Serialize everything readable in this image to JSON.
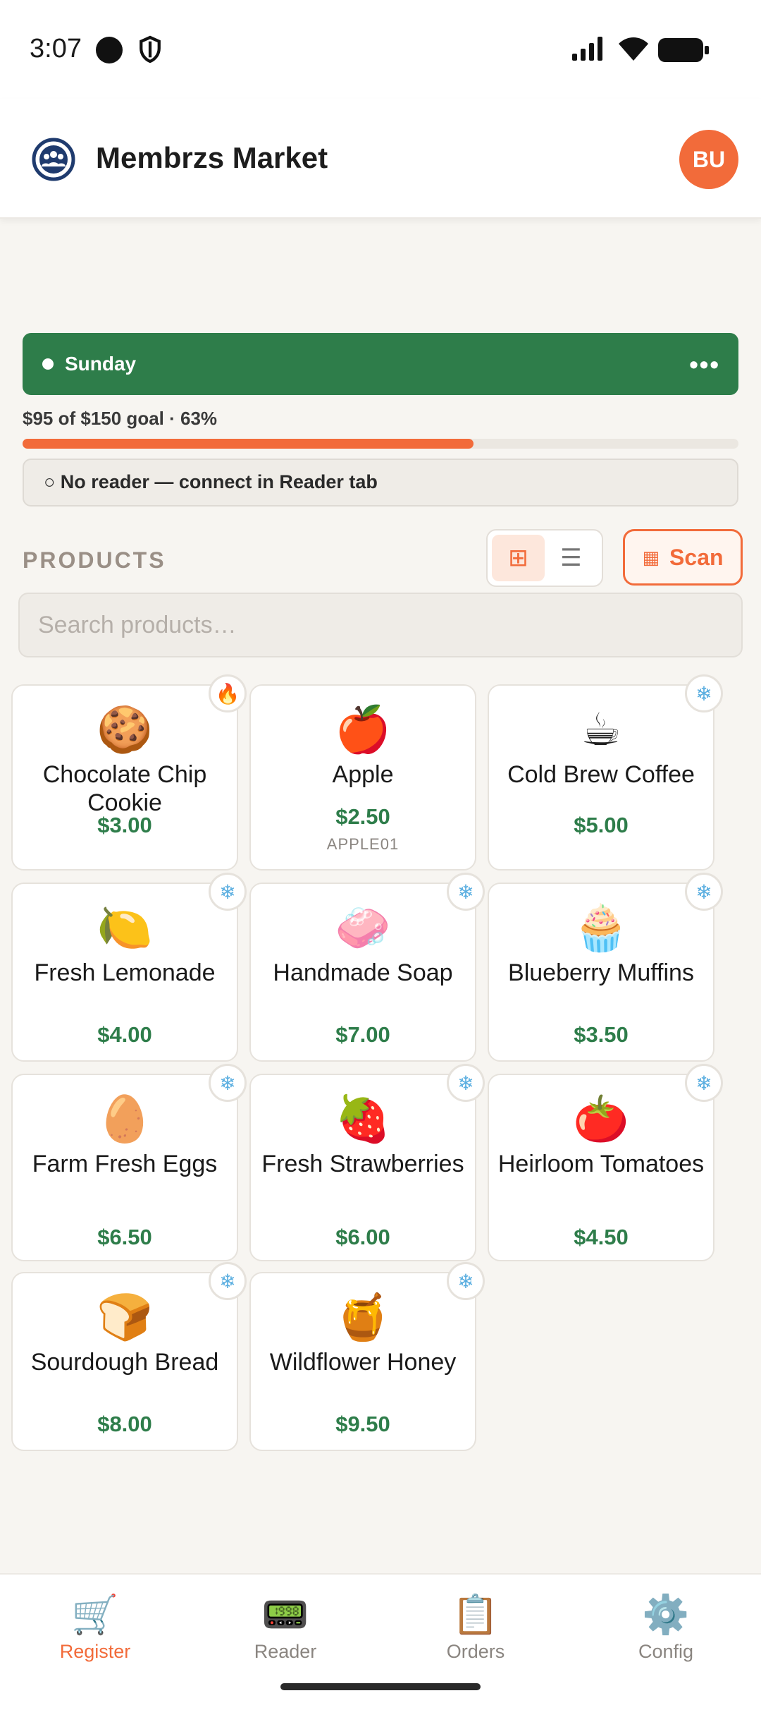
{
  "status": {
    "time": "3:07"
  },
  "header": {
    "title": "Membrzs Market",
    "avatar_initials": "BU"
  },
  "session": {
    "label": "Sunday",
    "more_label": "•••",
    "color": "#2e7d4a"
  },
  "goal": {
    "text": "$95 of $150 goal · 63%",
    "progress": 0.63,
    "accent": "#f26b3a"
  },
  "reader": {
    "status_text": "○ No reader — connect in Reader tab"
  },
  "products": {
    "heading": "PRODUCTS",
    "grid_icon": "⊞",
    "list_icon": "☰",
    "scan_label": "Scan",
    "scan_icon": "▦",
    "search_placeholder": "Search products…",
    "items": [
      {
        "emoji": "🍪",
        "name": "Chocolate Chip Cookie",
        "price": "$3.00",
        "sku": "",
        "badge": "🔥"
      },
      {
        "emoji": "🍎",
        "name": "Apple",
        "price": "$2.50",
        "sku": "APPLE01",
        "badge": ""
      },
      {
        "emoji": "☕",
        "name": "Cold Brew Coffee",
        "price": "$5.00",
        "sku": "",
        "badge": "❄"
      },
      {
        "emoji": "🍋",
        "name": "Fresh Lemonade",
        "price": "$4.00",
        "sku": "",
        "badge": "❄"
      },
      {
        "emoji": "🧼",
        "name": "Handmade Soap",
        "price": "$7.00",
        "sku": "",
        "badge": "❄"
      },
      {
        "emoji": "🧁",
        "name": "Blueberry Muffins",
        "price": "$3.50",
        "sku": "",
        "badge": "❄"
      },
      {
        "emoji": "🥚",
        "name": "Farm Fresh Eggs",
        "price": "$6.50",
        "sku": "",
        "badge": "❄"
      },
      {
        "emoji": "🍓",
        "name": "Fresh Strawberries",
        "price": "$6.00",
        "sku": "",
        "badge": "❄"
      },
      {
        "emoji": "🍅",
        "name": "Heirloom Tomatoes",
        "price": "$4.50",
        "sku": "",
        "badge": "❄"
      },
      {
        "emoji": "🍞",
        "name": "Sourdough Bread",
        "price": "$8.00",
        "sku": "",
        "badge": "❄"
      },
      {
        "emoji": "🍯",
        "name": "Wildflower Honey",
        "price": "$9.50",
        "sku": "",
        "badge": "❄"
      }
    ]
  },
  "nav": {
    "register": {
      "label": "Register",
      "icon": "🛒"
    },
    "reader": {
      "label": "Reader",
      "icon": "📟"
    },
    "orders": {
      "label": "Orders",
      "icon": "📋"
    },
    "config": {
      "label": "Config",
      "icon": "⚙️"
    }
  }
}
